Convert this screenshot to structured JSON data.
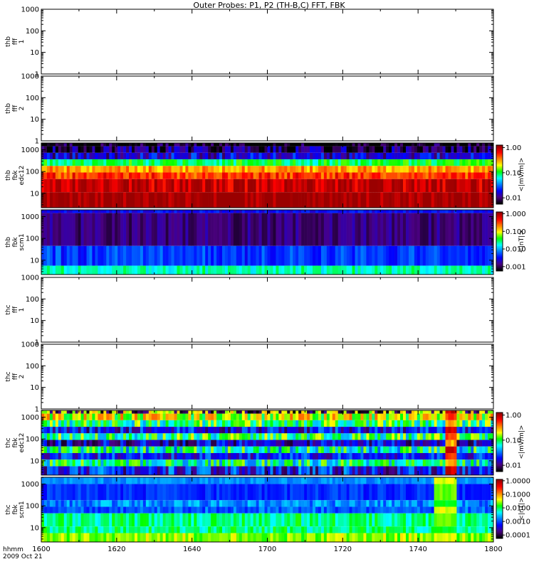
{
  "title": "Outer Probes: P1, P2 (TH-B,C) FFT, FBK",
  "footer": {
    "label1": "hhmm",
    "label2": "2009 Oct 21"
  },
  "chart_data": [
    {
      "type": "heatmap",
      "panel_label": [
        "thb",
        "fff",
        "1"
      ],
      "empty": true,
      "y_scale": "log",
      "ylim": [
        1,
        1000
      ],
      "y_ticks": [
        "1",
        "10",
        "100",
        "1000"
      ]
    },
    {
      "type": "heatmap",
      "panel_label": [
        "thb",
        "fff",
        "2"
      ],
      "empty": true,
      "y_scale": "log",
      "ylim": [
        1,
        1000
      ],
      "y_ticks": [
        "1",
        "10",
        "100",
        "1000"
      ]
    },
    {
      "type": "heatmap",
      "panel_label": [
        "thb",
        "fbk",
        "edc12"
      ],
      "y_scale": "log",
      "ylim": [
        2.2,
        2048
      ],
      "y_ticks": [
        "10",
        "100",
        "1000"
      ],
      "colorbar": {
        "label": "<|mV/m|>",
        "scale": "log",
        "ticks": [
          "0.01",
          "0.10",
          "1.00"
        ]
      },
      "bands": [
        {
          "f_low": 1448,
          "f_high": 2048,
          "typical": 0.003,
          "alt": 0.008
        },
        {
          "f_low": 724,
          "f_high": 1448,
          "typical": 0.012,
          "alt": 0.006
        },
        {
          "f_low": 362,
          "f_high": 724,
          "typical": 0.02,
          "alt": 0.012
        },
        {
          "f_low": 181,
          "f_high": 362,
          "typical": 0.1,
          "alt": 0.09
        },
        {
          "f_low": 90.5,
          "f_high": 181,
          "typical": 0.35,
          "alt": 0.3
        },
        {
          "f_low": 45.3,
          "f_high": 90.5,
          "typical": 0.6,
          "alt": 0.5
        },
        {
          "f_low": 11.3,
          "f_high": 45.3,
          "typical": 1.2,
          "alt": 0.9
        },
        {
          "f_low": 2.2,
          "f_high": 11.3,
          "typical": 1.3,
          "alt": 1.3
        }
      ]
    },
    {
      "type": "heatmap",
      "panel_label": [
        "thb",
        "fbk",
        "scm1"
      ],
      "y_scale": "log",
      "ylim": [
        2.2,
        2048
      ],
      "y_ticks": [
        "10",
        "100",
        "1000"
      ],
      "colorbar": {
        "label": "<|nT|>",
        "scale": "log",
        "ticks": [
          "0.001",
          "0.010",
          "0.100",
          "1.000"
        ]
      },
      "bands": [
        {
          "f_low": 1448,
          "f_high": 2048,
          "typical": 0.003,
          "alt": 0.003
        },
        {
          "f_low": 45.3,
          "f_high": 1448,
          "typical": 0.0012,
          "alt": 0.0013
        },
        {
          "f_low": 5.6,
          "f_high": 45.3,
          "typical": 0.004,
          "alt": 0.005
        },
        {
          "f_low": 2.2,
          "f_high": 5.6,
          "typical": 0.02,
          "alt": 0.025
        }
      ]
    },
    {
      "type": "heatmap",
      "panel_label": [
        "thc",
        "fff",
        "1"
      ],
      "empty": true,
      "y_scale": "log",
      "ylim": [
        1,
        1000
      ],
      "y_ticks": [
        "1",
        "10",
        "100",
        "1000"
      ]
    },
    {
      "type": "heatmap",
      "panel_label": [
        "thc",
        "fff",
        "2"
      ],
      "empty": true,
      "y_scale": "log",
      "ylim": [
        1,
        1000
      ],
      "y_ticks": [
        "1",
        "10",
        "100",
        "1000"
      ]
    },
    {
      "type": "heatmap",
      "panel_label": [
        "thc",
        "fbk",
        "edc12"
      ],
      "y_scale": "log",
      "ylim": [
        2.2,
        2048
      ],
      "y_ticks": [
        "10",
        "100",
        "1000"
      ],
      "colorbar": {
        "label": "<|mV/m|>",
        "scale": "log",
        "ticks": [
          "0.01",
          "0.10",
          "1.00"
        ]
      },
      "event": {
        "time_start": "17:47",
        "time_end": "17:50",
        "peak": 1.2
      },
      "bands": [
        {
          "f_low": 1448,
          "f_high": 2048,
          "typical": 0.008,
          "alt": 0.2
        },
        {
          "f_low": 724,
          "f_high": 1448,
          "typical": 0.12,
          "alt": 0.3
        },
        {
          "f_low": 362,
          "f_high": 724,
          "typical": 0.06,
          "alt": 0.15
        },
        {
          "f_low": 181,
          "f_high": 362,
          "typical": 0.025,
          "alt": 0.012
        },
        {
          "f_low": 90.5,
          "f_high": 181,
          "typical": 0.06,
          "alt": 0.15
        },
        {
          "f_low": 45.3,
          "f_high": 90.5,
          "typical": 0.02,
          "alt": 0.01
        },
        {
          "f_low": 22.6,
          "f_high": 45.3,
          "typical": 0.04,
          "alt": 0.12
        },
        {
          "f_low": 11.3,
          "f_high": 22.6,
          "typical": 0.025,
          "alt": 0.015
        },
        {
          "f_low": 5.6,
          "f_high": 11.3,
          "typical": 0.05,
          "alt": 0.12
        },
        {
          "f_low": 2.2,
          "f_high": 5.6,
          "typical": 0.012,
          "alt": 0.03
        }
      ]
    },
    {
      "type": "heatmap",
      "panel_label": [
        "thc",
        "fbk",
        "scm1"
      ],
      "y_scale": "log",
      "ylim": [
        2.2,
        2048
      ],
      "y_ticks": [
        "10",
        "100",
        "1000"
      ],
      "colorbar": {
        "label": "<|nT|>",
        "scale": "log",
        "ticks": [
          "0.0001",
          "0.0010",
          "0.0100",
          "0.1000",
          "1.0000"
        ]
      },
      "event": {
        "time_start": "17:44",
        "time_end": "17:50",
        "peak": 0.05
      },
      "bands": [
        {
          "f_low": 1000,
          "f_high": 2048,
          "typical": 0.0018,
          "alt": 0.0018
        },
        {
          "f_low": 181,
          "f_high": 1000,
          "typical": 0.0007,
          "alt": 0.0008
        },
        {
          "f_low": 90.5,
          "f_high": 181,
          "typical": 0.0012,
          "alt": 0.0025
        },
        {
          "f_low": 45.3,
          "f_high": 90.5,
          "typical": 0.0015,
          "alt": 0.0009
        },
        {
          "f_low": 11.3,
          "f_high": 45.3,
          "typical": 0.006,
          "alt": 0.012
        },
        {
          "f_low": 5.6,
          "f_high": 11.3,
          "typical": 0.012,
          "alt": 0.006
        },
        {
          "f_low": 2.2,
          "f_high": 5.6,
          "typical": 0.02,
          "alt": 0.04
        }
      ]
    }
  ],
  "x_axis": {
    "range": [
      "16:00",
      "18:00"
    ],
    "ticks": [
      "1600",
      "1620",
      "1640",
      "1700",
      "1720",
      "1740",
      "1800"
    ]
  },
  "colormap": [
    "#000000",
    "#4b0082",
    "#0000ff",
    "#0080ff",
    "#00ffff",
    "#00ff00",
    "#ffff00",
    "#ff8000",
    "#ff0000",
    "#9a0000"
  ]
}
